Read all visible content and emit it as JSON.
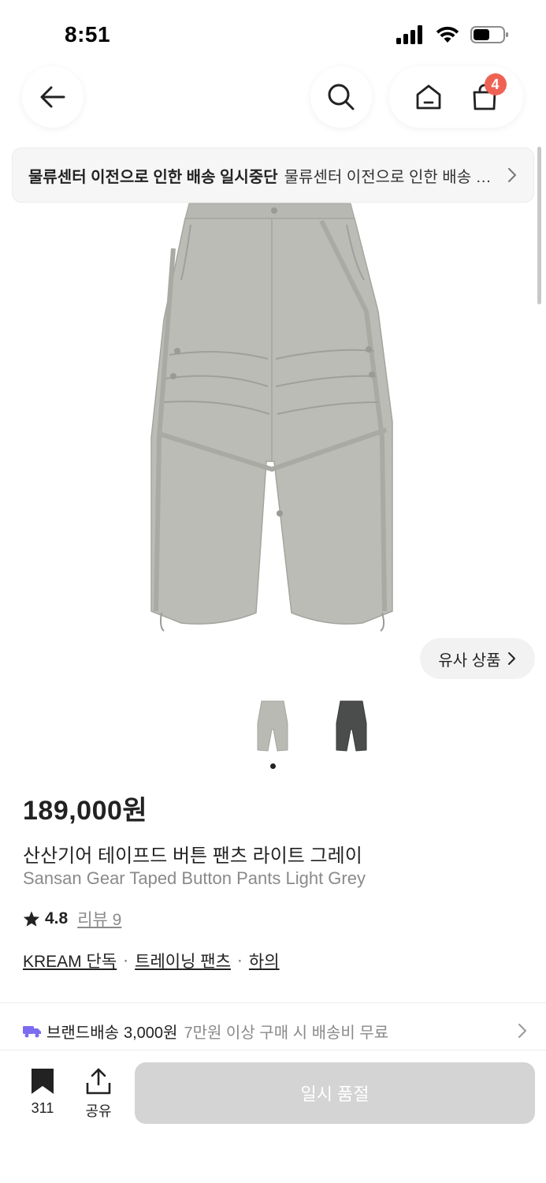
{
  "status_bar": {
    "time": "8:51"
  },
  "nav": {
    "back_icon": "arrow-left-icon",
    "search_icon": "search-icon",
    "home_icon": "home-icon",
    "cart_icon": "shopping-bag-icon",
    "cart_count": "4"
  },
  "notice": {
    "title": "물류센터 이전으로 인한 배송 일시중단",
    "body": "물류센터 이전으로 인한 배송 일시중단 안내",
    "arrow_icon": "chevron-right-icon"
  },
  "gallery": {
    "similar_label": "유사 상품",
    "thumbnails": [
      "light-grey-pants",
      "charcoal-pants"
    ],
    "current_index": 1,
    "total": 2
  },
  "product": {
    "price": "189,000원",
    "name_ko": "산산기어 테이프드 버튼 팬츠 라이트 그레이",
    "name_en": "Sansan Gear Taped Button Pants Light Grey",
    "rating": "4.8",
    "review_label": "리뷰 9",
    "tags": [
      "KREAM 단독",
      "트레이닝 팬츠",
      "하의"
    ]
  },
  "shipping": {
    "label": "브랜드배송",
    "price": "3,000원",
    "condition": "7만원 이상 구매 시 배송비 무료"
  },
  "bottom_bar": {
    "save_count": "311",
    "share_label": "공유",
    "action_label": "일시 품절"
  },
  "colors": {
    "accent_badge": "#ef6253",
    "shipping_truck": "#7b6cf0",
    "disabled_button": "#d4d4d4",
    "pants_light": "#b9bab4",
    "pants_dark": "#4a4d4b"
  }
}
